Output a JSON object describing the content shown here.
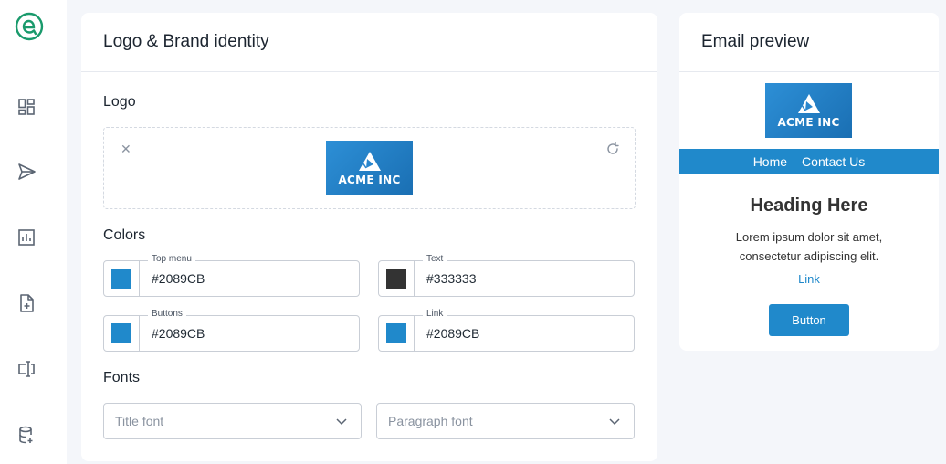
{
  "sidebar": {
    "items": [
      {
        "icon": "dashboard-icon"
      },
      {
        "icon": "send-icon"
      },
      {
        "icon": "report-chart-icon"
      },
      {
        "icon": "new-file-icon"
      },
      {
        "icon": "form-field-icon"
      },
      {
        "icon": "database-icon"
      }
    ]
  },
  "main": {
    "title": "Logo & Brand identity",
    "logo_section": {
      "label": "Logo",
      "logo_text": "ACME INC"
    },
    "colors_section": {
      "label": "Colors",
      "fields": [
        {
          "label": "Top menu",
          "value": "#2089CB",
          "swatch": "#2089CB"
        },
        {
          "label": "Text",
          "value": "#333333",
          "swatch": "#333333"
        },
        {
          "label": "Buttons",
          "value": "#2089CB",
          "swatch": "#2089CB"
        },
        {
          "label": "Link",
          "value": "#2089CB",
          "swatch": "#2089CB"
        }
      ]
    },
    "fonts_section": {
      "label": "Fonts",
      "title_font_placeholder": "Title font",
      "paragraph_font_placeholder": "Paragraph font"
    }
  },
  "preview": {
    "title": "Email preview",
    "logo_text": "ACME INC",
    "nav": [
      "Home",
      "Contact Us"
    ],
    "heading": "Heading Here",
    "paragraph": "Lorem ipsum dolor sit amet, consectetur adipiscing elit.",
    "link": "Link",
    "button": "Button"
  },
  "colors": {
    "brand_green": "#1a9a6c",
    "accent_blue": "#2089CB",
    "text_dark": "#333333"
  }
}
